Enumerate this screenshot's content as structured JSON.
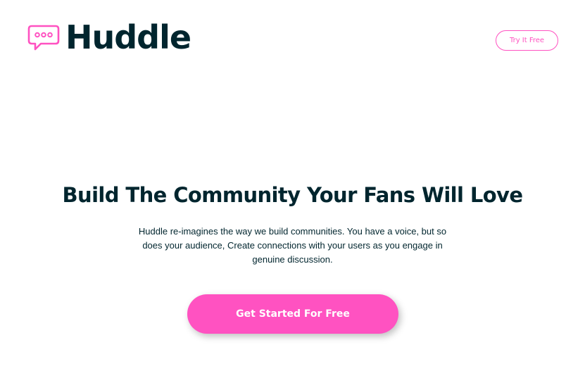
{
  "brand": {
    "name": "Huddle",
    "accent_color": "#ff52c1",
    "text_color": "#00252e",
    "logo_icon": "chat-bubble-icon"
  },
  "header": {
    "try_button_label": "Try It Free"
  },
  "hero": {
    "title": "Build The Community Your Fans Will Love",
    "description": "Huddle re-imagines the way we build communities. You have a voice, but so does your audience, Create connections with your users as you engage in genuine discussion.",
    "cta_label": "Get Started For Free"
  }
}
